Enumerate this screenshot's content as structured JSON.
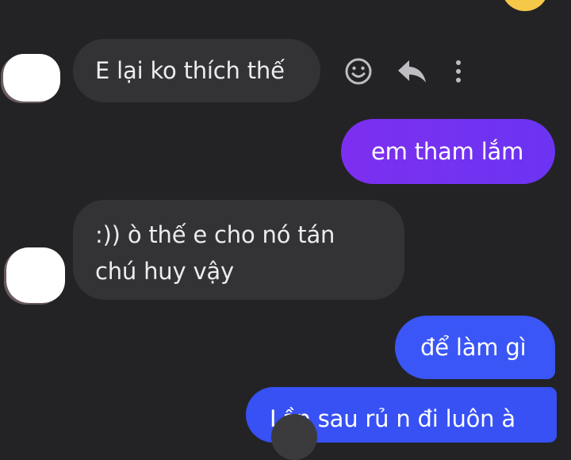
{
  "messages": [
    {
      "from": "other",
      "text": "E lại ko thích thế"
    },
    {
      "from": "me",
      "text": "em tham lắm"
    },
    {
      "from": "other",
      "lines": [
        ":)) ò thế e cho nó tán",
        "chú huy vậy"
      ]
    },
    {
      "from": "me",
      "text": "để làm gì"
    },
    {
      "from": "me",
      "text": "Lần sau rủ n đi luôn à"
    }
  ],
  "message_actions": {
    "icons": [
      "emoji-icon",
      "reply-icon",
      "more-icon"
    ]
  },
  "colors": {
    "background": "#232326",
    "incoming_bubble": "#333336",
    "outgoing_purple": "#7d2ff0",
    "outgoing_blue": "#3b56f6",
    "reaction_yellow": "#f5c84a"
  }
}
